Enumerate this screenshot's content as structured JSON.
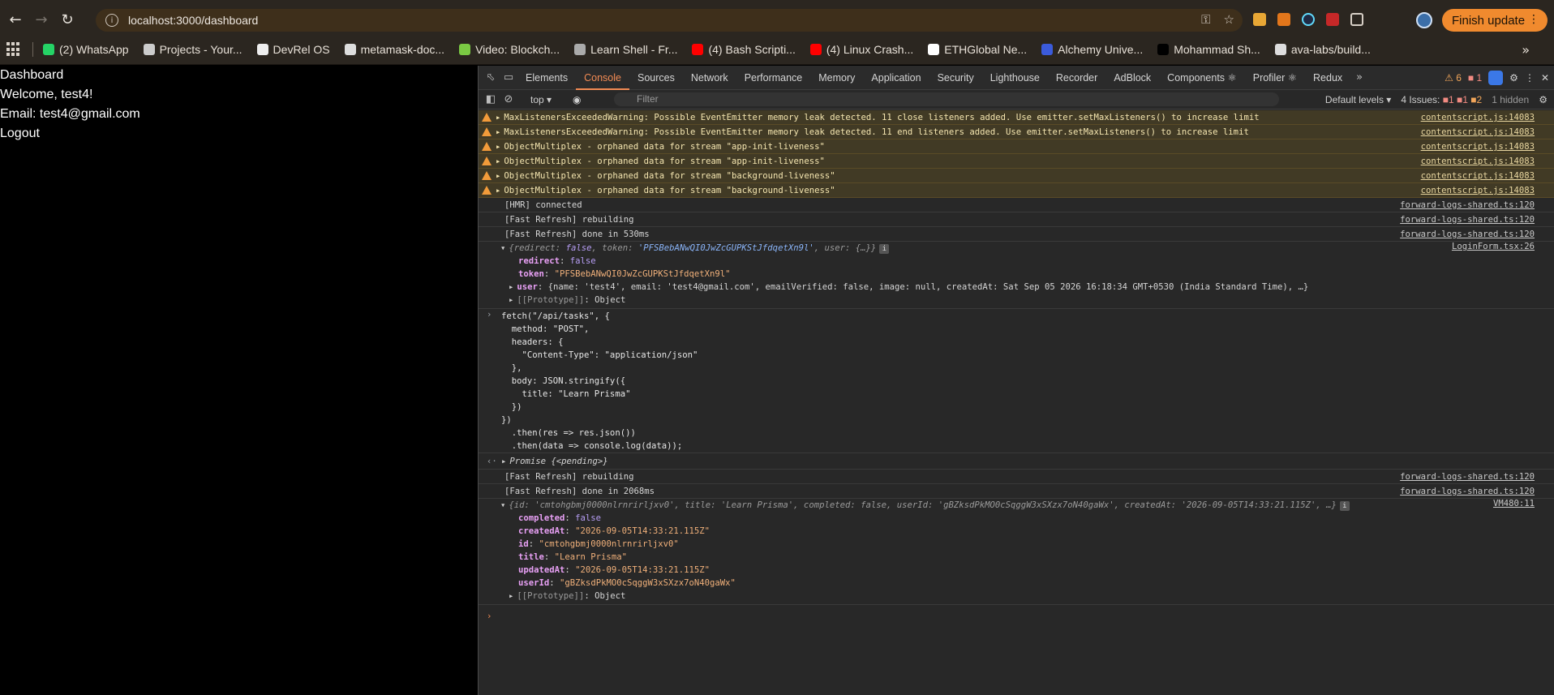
{
  "browser": {
    "url": "localhost:3000/dashboard",
    "finish_update_label": "Finish update",
    "bookmarks": [
      {
        "label": "(2) WhatsApp",
        "icon": "whatsapp-icon",
        "color": "#25d366"
      },
      {
        "label": "Projects - Your...",
        "icon": "projects-icon",
        "color": "#cccccc"
      },
      {
        "label": "DevRel OS",
        "icon": "devrel-icon",
        "color": "#eeeeee"
      },
      {
        "label": "metamask-doc...",
        "icon": "github-icon",
        "color": "#dddddd"
      },
      {
        "label": "Video: Blockch...",
        "icon": "video-icon",
        "color": "#7ac943"
      },
      {
        "label": "Learn Shell - Fr...",
        "icon": "shell-icon",
        "color": "#aaaaaa"
      },
      {
        "label": "(4) Bash Scripti...",
        "icon": "youtube-icon",
        "color": "#ff0000"
      },
      {
        "label": "(4) Linux Crash...",
        "icon": "youtube-icon",
        "color": "#ff0000"
      },
      {
        "label": "ETHGlobal Ne...",
        "icon": "ethglobal-icon",
        "color": "#ffffff"
      },
      {
        "label": "Alchemy Unive...",
        "icon": "alchemy-icon",
        "color": "#3b5bdb"
      },
      {
        "label": "Mohammad Sh...",
        "icon": "dev-icon",
        "color": "#000000"
      },
      {
        "label": "ava-labs/build...",
        "icon": "github-icon",
        "color": "#dddddd"
      }
    ]
  },
  "page": {
    "title": "Dashboard",
    "welcome": "Welcome, test4!",
    "email": "Email: test4@gmail.com",
    "logout": "Logout"
  },
  "devtools": {
    "tabs": [
      "Elements",
      "Console",
      "Sources",
      "Network",
      "Performance",
      "Memory",
      "Application",
      "Security",
      "Lighthouse",
      "Recorder",
      "AdBlock",
      "Components ⚛",
      "Profiler ⚛",
      "Redux"
    ],
    "active_tab": "Console",
    "warn_count": "6",
    "err_count": "1",
    "context": "top",
    "filter_placeholder": "Filter",
    "levels": "Default levels",
    "issues_label": "4 Issues:",
    "issues_err": "1",
    "issues_warn": "1",
    "issues_info": "2",
    "hidden": "1 hidden"
  },
  "console": {
    "warnings": [
      {
        "text": "MaxListenersExceededWarning: Possible EventEmitter memory leak detected. 11 close listeners added. Use emitter.setMaxListeners() to increase limit",
        "src": "contentscript.js:14083"
      },
      {
        "text": "MaxListenersExceededWarning: Possible EventEmitter memory leak detected. 11 end listeners added. Use emitter.setMaxListeners() to increase limit",
        "src": "contentscript.js:14083"
      },
      {
        "text": "ObjectMultiplex - orphaned data for stream \"app-init-liveness\"",
        "src": "contentscript.js:14083"
      },
      {
        "text": "ObjectMultiplex - orphaned data for stream \"app-init-liveness\"",
        "src": "contentscript.js:14083"
      },
      {
        "text": "ObjectMultiplex - orphaned data for stream \"background-liveness\"",
        "src": "contentscript.js:14083"
      },
      {
        "text": "ObjectMultiplex - orphaned data for stream \"background-liveness\"",
        "src": "contentscript.js:14083"
      }
    ],
    "logs1": [
      {
        "text": "[HMR] connected",
        "src": "forward-logs-shared.ts:120"
      },
      {
        "text": "[Fast Refresh] rebuilding",
        "src": "forward-logs-shared.ts:120"
      },
      {
        "text": "[Fast Refresh] done in 530ms",
        "src": "forward-logs-shared.ts:120"
      }
    ],
    "login_obj": {
      "summary_redirect": "false",
      "summary_token": "'PFSBebANwQI0JwZcGUPKStJfdqetXn9l'",
      "summary_user": "{…}",
      "src": "LoginForm.tsx:26",
      "redirect": "false",
      "token": "\"PFSBebANwQI0JwZcGUPKStJfdqetXn9l\"",
      "user_line": "{name: 'test4', email: 'test4@gmail.com', emailVerified: false, image: null, createdAt: Sat Sep 05 2026 16:18:34 GMT+0530 (India Standard Time), …}",
      "proto": "Object"
    },
    "fetch_code": [
      "fetch(\"/api/tasks\", {",
      "  method: \"POST\",",
      "  headers: {",
      "    \"Content-Type\": \"application/json\"",
      "  },",
      "  body: JSON.stringify({",
      "    title: \"Learn Prisma\"",
      "  })",
      "})",
      "  .then(res => res.json())",
      "  .then(data => console.log(data));"
    ],
    "promise": "Promise {<pending>}",
    "logs2": [
      {
        "text": "[Fast Refresh] rebuilding",
        "src": "forward-logs-shared.ts:120"
      },
      {
        "text": "[Fast Refresh] done in 2068ms",
        "src": "forward-logs-shared.ts:120"
      }
    ],
    "task_obj": {
      "summary": "{id: 'cmtohgbmj0000nlrnrirljxv0', title: 'Learn Prisma', completed: false, userId: 'gBZksdPkMO0cSqggW3xSXzx7oN40gaWx', createdAt: '2026-09-05T14:33:21.115Z', …}",
      "src": "VM480:11",
      "completed": "false",
      "createdAt": "\"2026-09-05T14:33:21.115Z\"",
      "id": "\"cmtohgbmj0000nlrnrirljxv0\"",
      "title": "\"Learn Prisma\"",
      "updatedAt": "\"2026-09-05T14:33:21.115Z\"",
      "userId": "\"gBZksdPkMO0cSqggW3xSXzx7oN40gaWx\"",
      "proto": "Object"
    }
  }
}
